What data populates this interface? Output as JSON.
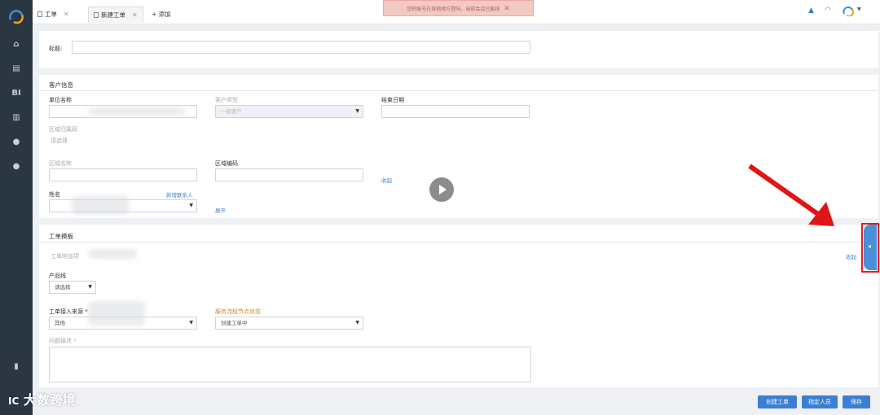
{
  "tabs": [
    {
      "label": "工单"
    },
    {
      "label": "新建工单"
    },
    {
      "label": "+ 添加"
    }
  ],
  "alert": {
    "text": "您的账号在其他地方登陆，当前会话已离线"
  },
  "form": {
    "title_label": "标题:",
    "customer_section": "客户信息",
    "unit_name_label": "单位名称",
    "customer_level_label": "客户类型",
    "customer_level_value": "一般客户",
    "end_date_label": "结束日期",
    "region_code_label": "区域归属码",
    "region_code_value": "请选择",
    "region_name_label": "区域名称",
    "region_num_label": "区域编码",
    "collapse_link": "收起",
    "contact_label": "姓名",
    "new_contact_link": "新增联系人",
    "expand_link": "展开",
    "workorder_section": "工单模板",
    "workorder_sub": "工单附加项",
    "collapse_right": "收起",
    "product_label": "产品线",
    "product_value": "请选择",
    "access_label": "工单接入来源 *",
    "access_value": "其他",
    "flow_label": "服务流程节点状态",
    "flow_value": "创建工单中",
    "problem_label": "问题描述 *"
  },
  "buttons": {
    "create": "创建工单",
    "assign": "指定人员",
    "save": "保存"
  },
  "watermark": {
    "main": "大数跨境",
    "prefix": "IC"
  }
}
